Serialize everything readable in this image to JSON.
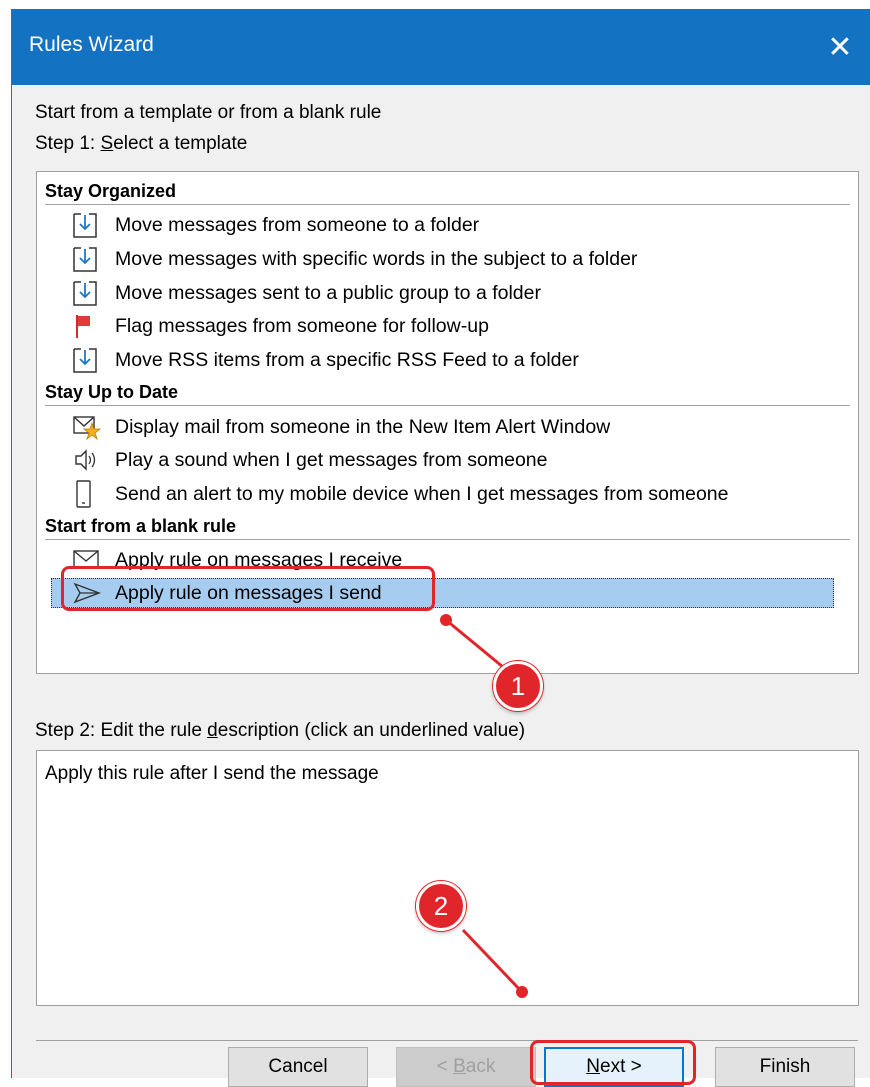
{
  "window": {
    "title": "Rules Wizard",
    "close_glyph": "✕"
  },
  "intro_text": "Start from a template or from a blank rule",
  "step1": {
    "prefix": "Step 1: ",
    "hotkey": "S",
    "rest": "elect a template"
  },
  "groups": [
    {
      "header": "Stay Organized",
      "items": [
        {
          "icon": "move-to-folder-icon",
          "label": "Move messages from someone to a folder"
        },
        {
          "icon": "move-to-folder-icon",
          "label": "Move messages with specific words in the subject to a folder"
        },
        {
          "icon": "move-to-folder-icon",
          "label": "Move messages sent to a public group to a folder"
        },
        {
          "icon": "flag-icon",
          "label": "Flag messages from someone for follow-up"
        },
        {
          "icon": "move-to-folder-icon",
          "label": "Move RSS items from a specific RSS Feed to a folder"
        }
      ]
    },
    {
      "header": "Stay Up to Date",
      "items": [
        {
          "icon": "new-item-alert-icon",
          "label": "Display mail from someone in the New Item Alert Window"
        },
        {
          "icon": "speaker-icon",
          "label": "Play a sound when I get messages from someone"
        },
        {
          "icon": "mobile-device-icon",
          "label": "Send an alert to my mobile device when I get messages from someone"
        }
      ]
    },
    {
      "header": "Start from a blank rule",
      "items": [
        {
          "icon": "envelope-icon",
          "label": "Apply rule on messages I receive"
        },
        {
          "icon": "send-arrow-icon",
          "label": "Apply rule on messages I send",
          "selected": true
        }
      ]
    }
  ],
  "step2": {
    "prefix": "Step 2: Edit the rule ",
    "hotkey": "d",
    "rest": "escription (click an underlined value)"
  },
  "description_text": "Apply this rule after I send the message",
  "buttons": {
    "cancel": "Cancel",
    "back_prefix": "< ",
    "back_hotkey": "B",
    "back_rest": "ack",
    "next_hotkey": "N",
    "next_rest": "ext >",
    "finish": "Finish"
  },
  "annotations": {
    "badge1": "1",
    "badge2": "2",
    "color": "#e0262b"
  },
  "colors": {
    "titlebar": "#1372c2",
    "selection": "#a6cdf0"
  }
}
